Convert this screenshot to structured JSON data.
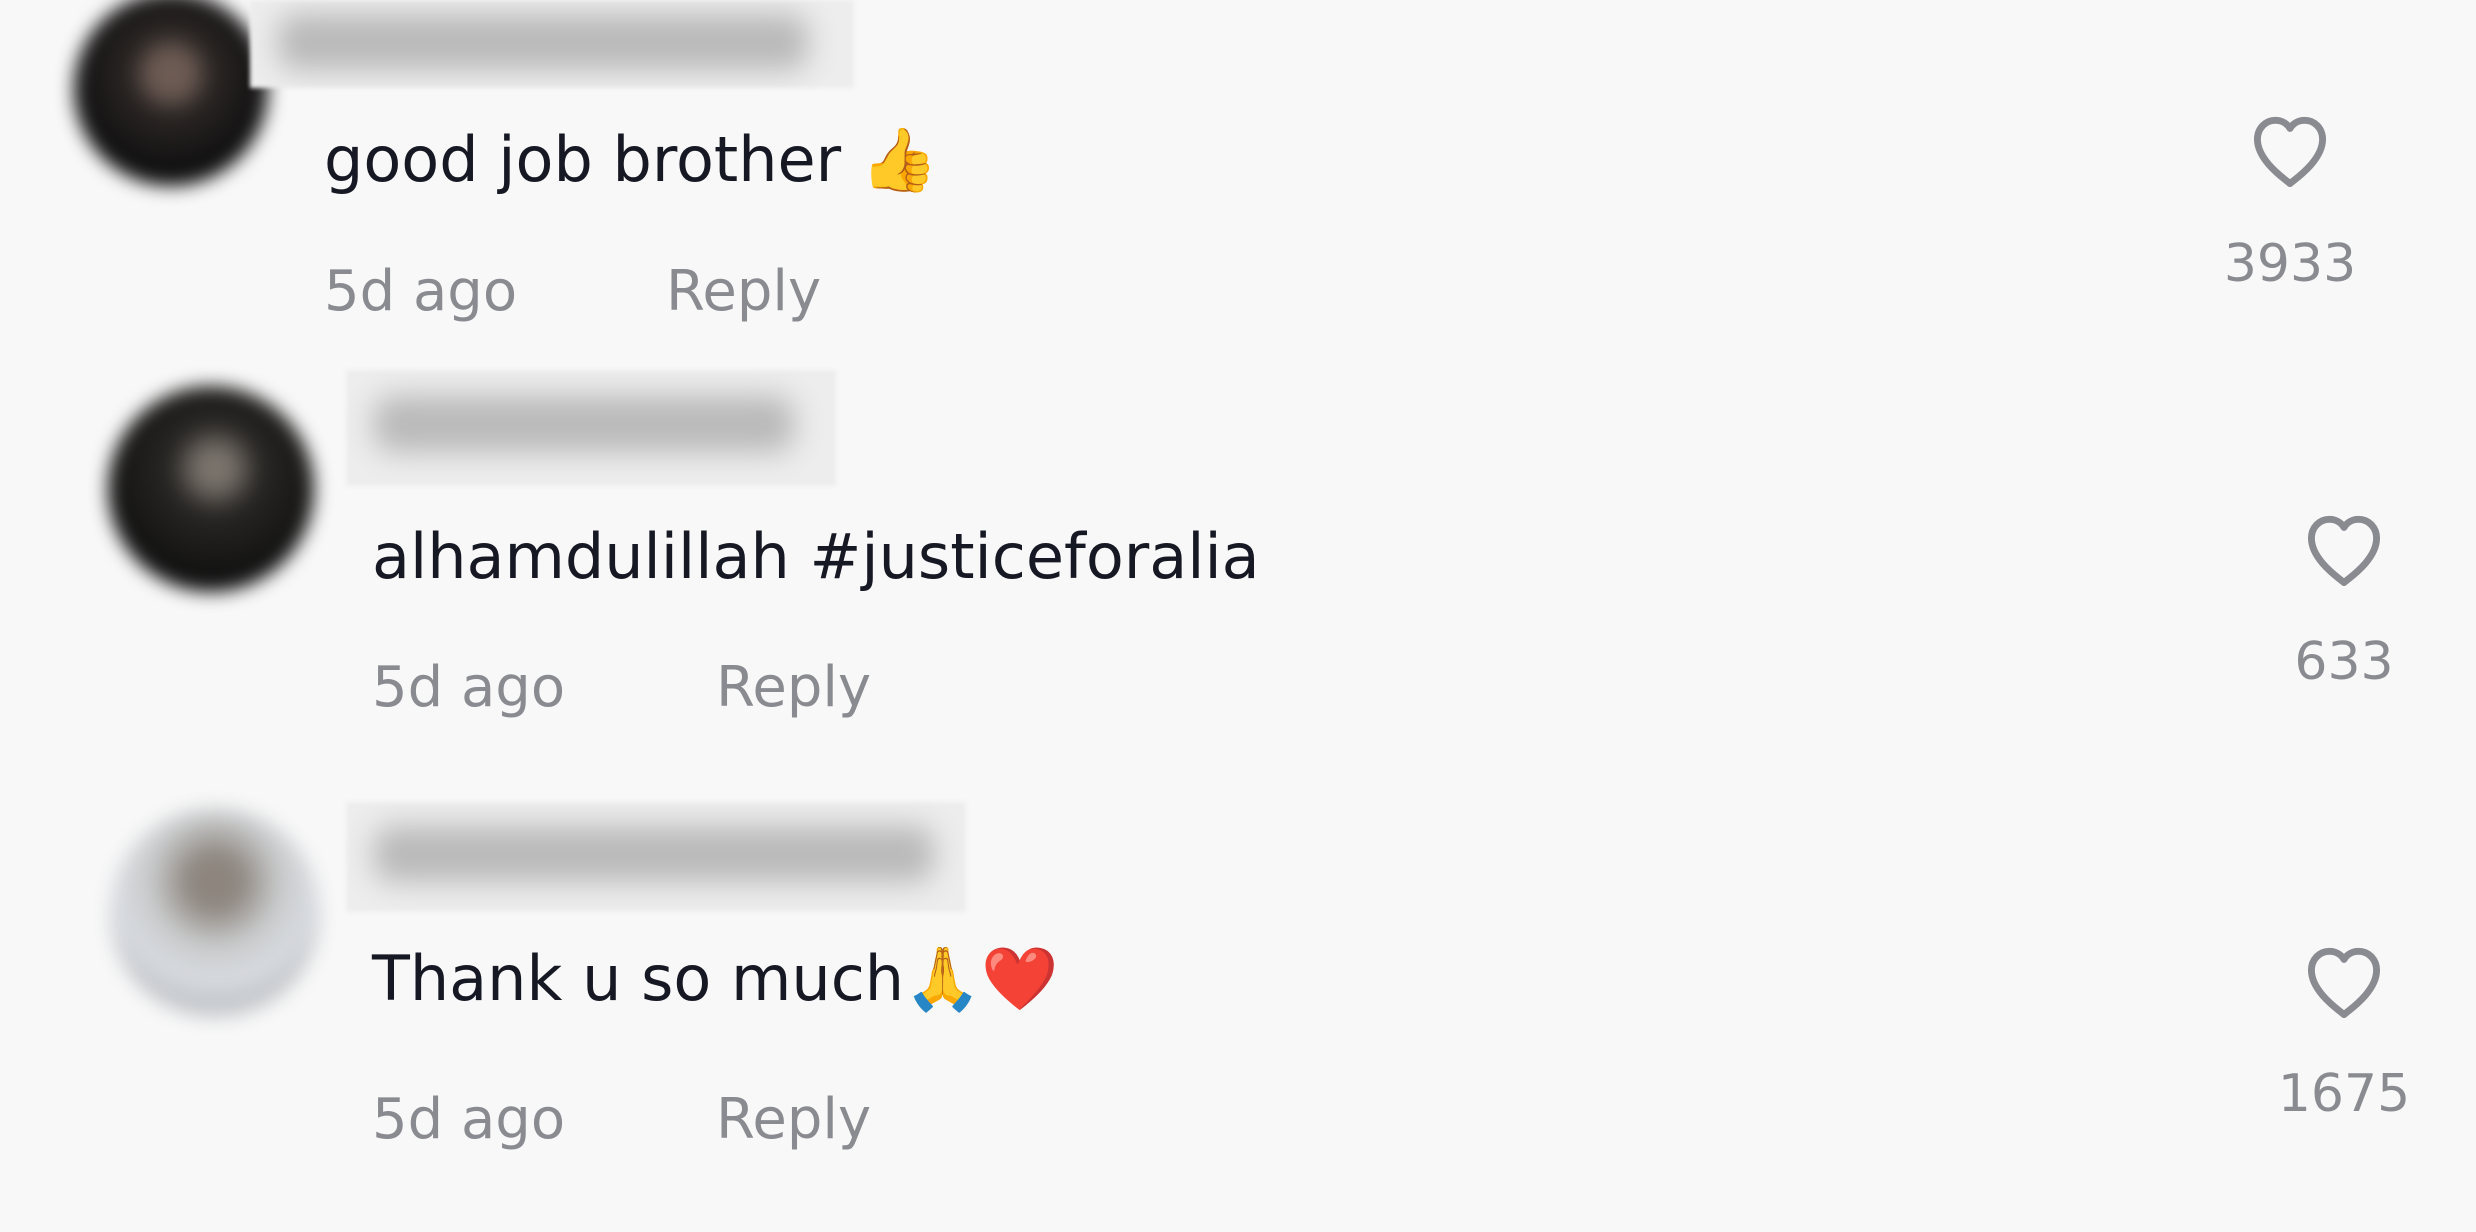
{
  "comments": [
    {
      "text": "good job brother 👍",
      "time": "5d ago",
      "reply": "Reply",
      "likes": "3933"
    },
    {
      "text": "alhamdulillah #justiceforalia",
      "time": "5d ago",
      "reply": "Reply",
      "likes": "633"
    },
    {
      "text": "Thank u so much🙏❤️",
      "time": "5d ago",
      "reply": "Reply",
      "likes": "1675"
    }
  ],
  "icons": {
    "like": "heart-outline-icon"
  },
  "colors": {
    "background": "#f8f8f8",
    "text": "#161823",
    "meta": "#8a8b91"
  }
}
